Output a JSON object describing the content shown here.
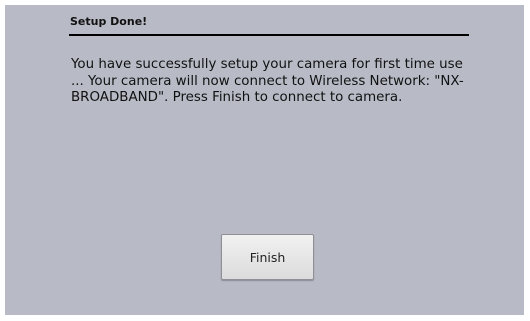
{
  "dialog": {
    "title": "Setup Done!",
    "message": "You have successfully setup your camera for first time use ... Your camera will now connect to Wireless Network: \"NX-BROADBAND\". Press Finish to connect to camera.",
    "finish_label": "Finish"
  },
  "colors": {
    "screen_background": "#b8bbc6",
    "text": "#111111"
  }
}
